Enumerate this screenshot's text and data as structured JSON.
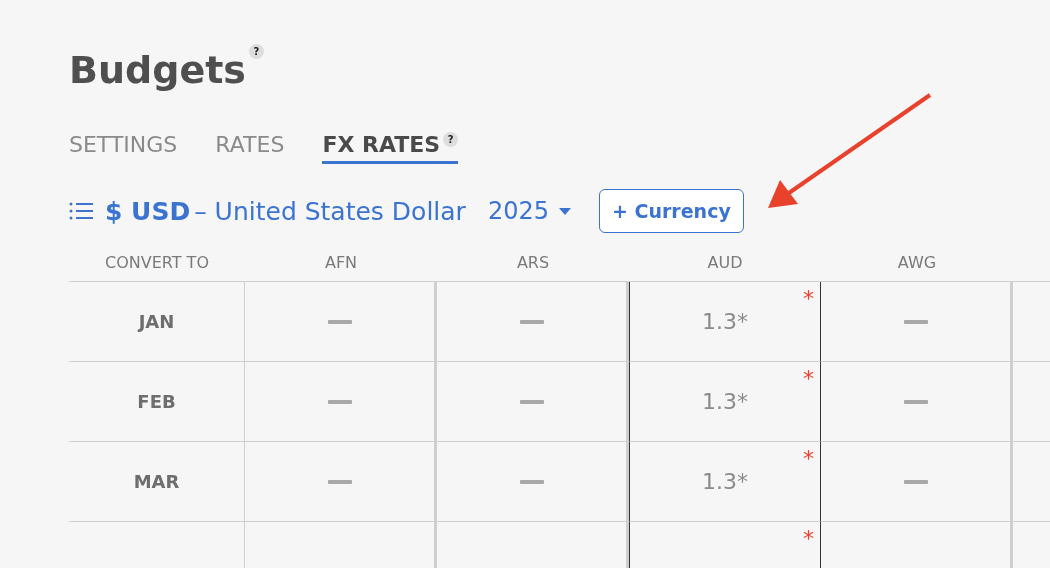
{
  "title": "Budgets",
  "title_help": "?",
  "tabs": [
    {
      "label": "SETTINGS",
      "selected": false
    },
    {
      "label": "RATES",
      "selected": false
    },
    {
      "label": "FX RATES",
      "selected": true,
      "help": "?"
    }
  ],
  "toolbar": {
    "symbol": "$ USD",
    "separator": "–",
    "currency_name": "United States Dollar",
    "year": "2025",
    "add_button": "+ Currency"
  },
  "table": {
    "columns": [
      {
        "label": "CONVERT TO",
        "selected": false
      },
      {
        "label": "AFN",
        "selected": false
      },
      {
        "label": "ARS",
        "selected": false
      },
      {
        "label": "AUD",
        "selected": true
      },
      {
        "label": "AWG",
        "selected": false
      },
      {
        "selected": false
      }
    ],
    "rows": [
      {
        "month": "JAN",
        "cells": [
          {
            "kind": "empty"
          },
          {
            "kind": "empty"
          },
          {
            "kind": "value",
            "value": "1.3*",
            "flag": "*"
          },
          {
            "kind": "empty"
          },
          {
            "kind": "blank"
          }
        ]
      },
      {
        "month": "FEB",
        "cells": [
          {
            "kind": "empty"
          },
          {
            "kind": "empty"
          },
          {
            "kind": "value",
            "value": "1.3*",
            "flag": "*"
          },
          {
            "kind": "empty"
          },
          {
            "kind": "blank"
          }
        ]
      },
      {
        "month": "MAR",
        "cells": [
          {
            "kind": "empty"
          },
          {
            "kind": "empty"
          },
          {
            "kind": "value",
            "value": "1.3*",
            "flag": "*"
          },
          {
            "kind": "empty"
          },
          {
            "kind": "blank"
          }
        ]
      },
      {
        "cells": [
          {
            "kind": "blank"
          },
          {
            "kind": "blank"
          },
          {
            "kind": "blank",
            "flag": "*"
          },
          {
            "kind": "blank"
          },
          {
            "kind": "blank"
          }
        ]
      }
    ]
  },
  "annotations": [
    {
      "kind": "arrow",
      "color": "#e8412c"
    }
  ]
}
